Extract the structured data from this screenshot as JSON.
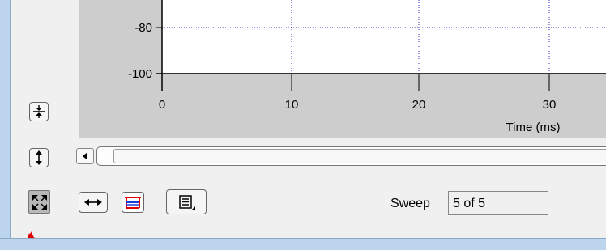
{
  "plot": {
    "y_ticks": [
      "-80",
      "-100"
    ],
    "x_ticks": [
      "0",
      "10",
      "20",
      "30"
    ],
    "x_label": "Time (ms)"
  },
  "toolbar_left": [
    {
      "name": "shrink-vertical",
      "icon": "arrows-converge-vertical-icon"
    },
    {
      "name": "expand-vertical",
      "icon": "arrows-diverge-vertical-icon"
    },
    {
      "name": "autoscale-all",
      "icon": "arrows-expand-four-corners-icon",
      "pressed": true
    }
  ],
  "toolbar_bottom": [
    {
      "name": "expand-horizontal",
      "icon": "arrows-left-right-icon"
    },
    {
      "name": "baseline",
      "icon": "red-blue-baseline-icon"
    },
    {
      "name": "sweep-list",
      "icon": "list-lines-icon"
    }
  ],
  "sweep": {
    "label": "Sweep",
    "value": "5 of 5"
  },
  "colors": {
    "grid": "#3030c8",
    "pointer": "#e00000",
    "window_edge": "#bcd4ec"
  }
}
